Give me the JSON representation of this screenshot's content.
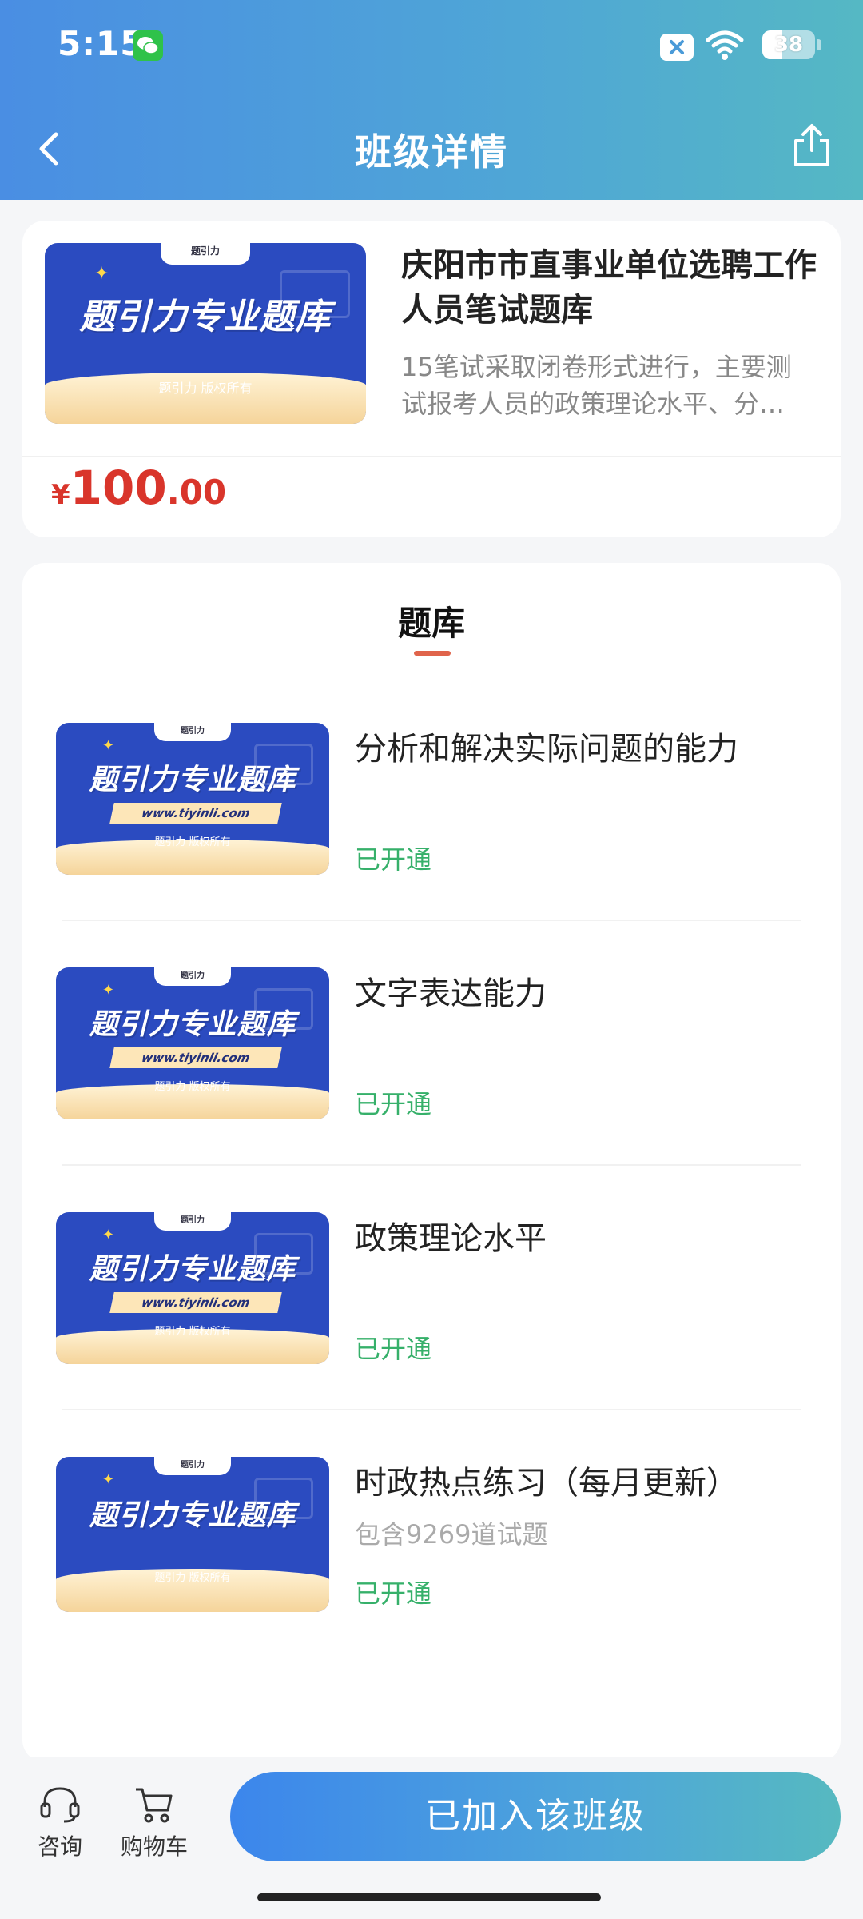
{
  "status_bar": {
    "time": "5:15",
    "battery": "38",
    "battery_level": 0.38
  },
  "nav": {
    "title": "班级详情"
  },
  "course": {
    "cover": {
      "brand": "题引力专业题库",
      "tab": "题引力",
      "copyright": "题引力 版权所有"
    },
    "title": "庆阳市市直事业单位选聘工作人员笔试题库",
    "description": "15笔试采取闭卷形式进行，主要测试报考人员的政策理论水平、分…",
    "price": {
      "symbol": "¥",
      "integer": "100",
      "decimal": ".00"
    }
  },
  "question_bank": {
    "section_title": "题库",
    "items": [
      {
        "name": "分析和解决实际问题的能力",
        "subtitle": "",
        "status": "已开通",
        "cover": {
          "brand": "题引力专业题库",
          "tab": "题引力",
          "url": "www.tiyinli.com",
          "copyright": "题引力 版权所有"
        }
      },
      {
        "name": "文字表达能力",
        "subtitle": "",
        "status": "已开通",
        "cover": {
          "brand": "题引力专业题库",
          "tab": "题引力",
          "url": "www.tiyinli.com",
          "copyright": "题引力 版权所有"
        }
      },
      {
        "name": "政策理论水平",
        "subtitle": "",
        "status": "已开通",
        "cover": {
          "brand": "题引力专业题库",
          "tab": "题引力",
          "url": "www.tiyinli.com",
          "copyright": "题引力 版权所有"
        }
      },
      {
        "name": "时政热点练习（每月更新）",
        "subtitle": "包含9269道试题",
        "status": "已开通",
        "cover": {
          "brand": "题引力专业题库",
          "tab": "题引力",
          "copyright": "题引力 版权所有"
        }
      }
    ]
  },
  "bottom_bar": {
    "consult_label": "咨询",
    "cart_label": "购物车",
    "join_button": "已加入该班级"
  },
  "colors": {
    "accent_blue": "#4a8ee3",
    "price_red": "#d9352b",
    "status_green": "#36b06a",
    "underline_orange": "#e0644b"
  }
}
